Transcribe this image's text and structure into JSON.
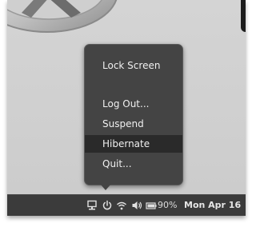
{
  "power_menu": {
    "items": [
      {
        "label": "Lock Screen",
        "highlighted": false
      },
      {
        "label": "Log Out...",
        "highlighted": false
      },
      {
        "label": "Suspend",
        "highlighted": false
      },
      {
        "label": "Hibernate",
        "highlighted": true
      },
      {
        "label": "Quit...",
        "highlighted": false
      }
    ]
  },
  "panel": {
    "icons": [
      "network-display-icon",
      "power-icon",
      "wifi-icon",
      "volume-icon",
      "battery-icon"
    ],
    "battery_percent": "90%",
    "clock": "Mon Apr 16"
  },
  "colors": {
    "desktop_bg": "#cfcfcf",
    "panel_bg": "#3b3b3b",
    "menu_bg": "#444444",
    "menu_highlight": "#2a2a2a",
    "text": "#f0f0f0"
  }
}
